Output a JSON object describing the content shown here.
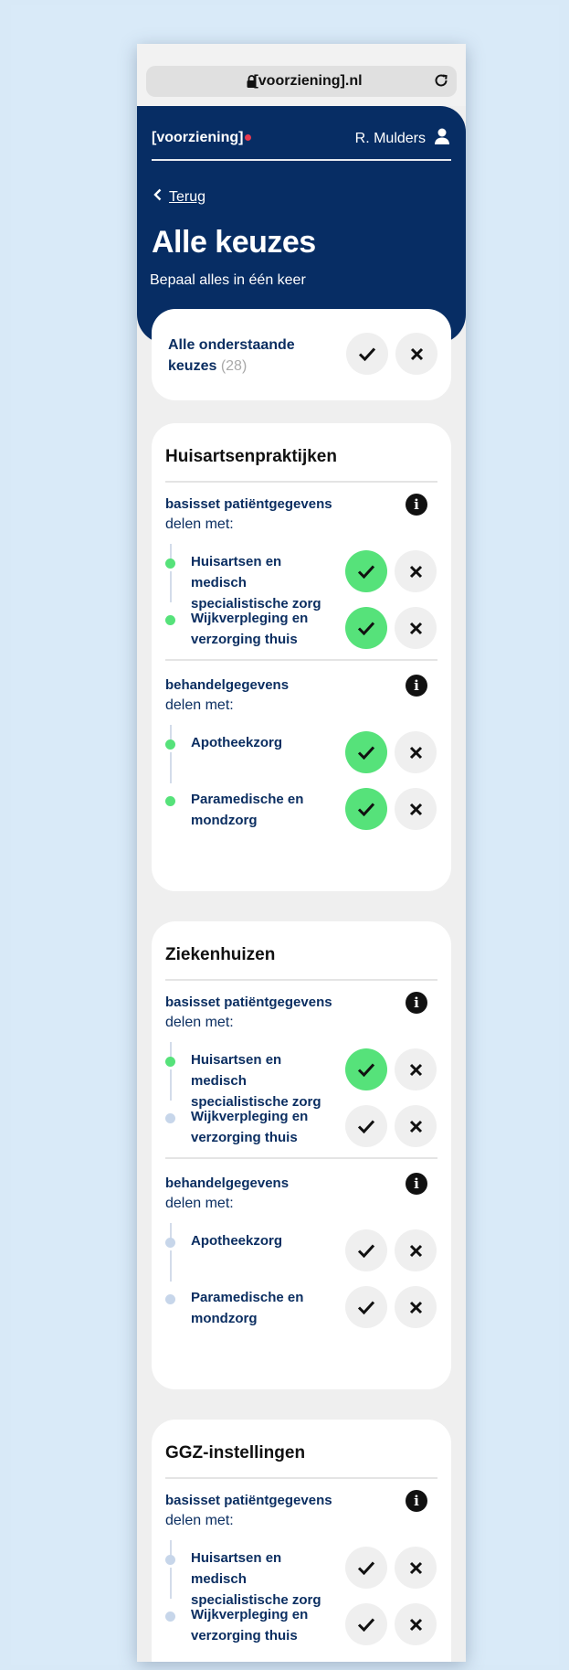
{
  "browser": {
    "url": "[voorziening].nl"
  },
  "header": {
    "brand": "[voorziening]",
    "user": "R. Mulders",
    "back": "Terug",
    "title": "Alle keuzes",
    "subtitle": "Bepaal alles in één keer"
  },
  "all_choices": {
    "label": "Alle onderstaande keuzes",
    "count": "(28)"
  },
  "colors": {
    "navy": "#072d64",
    "accent_dot": "#e8394f",
    "active_green": "#56e27a"
  },
  "icons": [
    "lock-icon",
    "reload-icon",
    "user-icon",
    "chevron-left-icon",
    "check-icon",
    "close-icon",
    "info-icon"
  ],
  "organizations": [
    {
      "title": "Huisartsenpraktijken",
      "sections": [
        {
          "title": "basisset patiëntgegevens",
          "subtitle": "delen met:",
          "items": [
            {
              "label": "Huisartsen en medisch specialistische zorg",
              "accepted": true
            },
            {
              "label": "Wijkverpleging en verzorging thuis",
              "accepted": true
            }
          ]
        },
        {
          "title": "behandelgegevens",
          "subtitle": "delen met:",
          "items": [
            {
              "label": "Apotheekzorg",
              "accepted": true
            },
            {
              "label": "Paramedische en mondzorg",
              "accepted": true
            }
          ]
        }
      ]
    },
    {
      "title": "Ziekenhuizen",
      "sections": [
        {
          "title": "basisset patiëntgegevens",
          "subtitle": "delen met:",
          "items": [
            {
              "label": "Huisartsen en medisch specialistische zorg",
              "accepted": true
            },
            {
              "label": "Wijkverpleging en verzorging thuis",
              "accepted": false
            }
          ]
        },
        {
          "title": "behandelgegevens",
          "subtitle": "delen met:",
          "items": [
            {
              "label": "Apotheekzorg",
              "accepted": false
            },
            {
              "label": "Paramedische en mondzorg",
              "accepted": false
            }
          ]
        }
      ]
    },
    {
      "title": "GGZ-instellingen",
      "sections": [
        {
          "title": "basisset patiëntgegevens",
          "subtitle": "delen met:",
          "items": [
            {
              "label": "Huisartsen en medisch specialistische zorg",
              "accepted": false
            },
            {
              "label": "Wijkverpleging en verzorging thuis",
              "accepted": false
            }
          ]
        }
      ]
    }
  ]
}
